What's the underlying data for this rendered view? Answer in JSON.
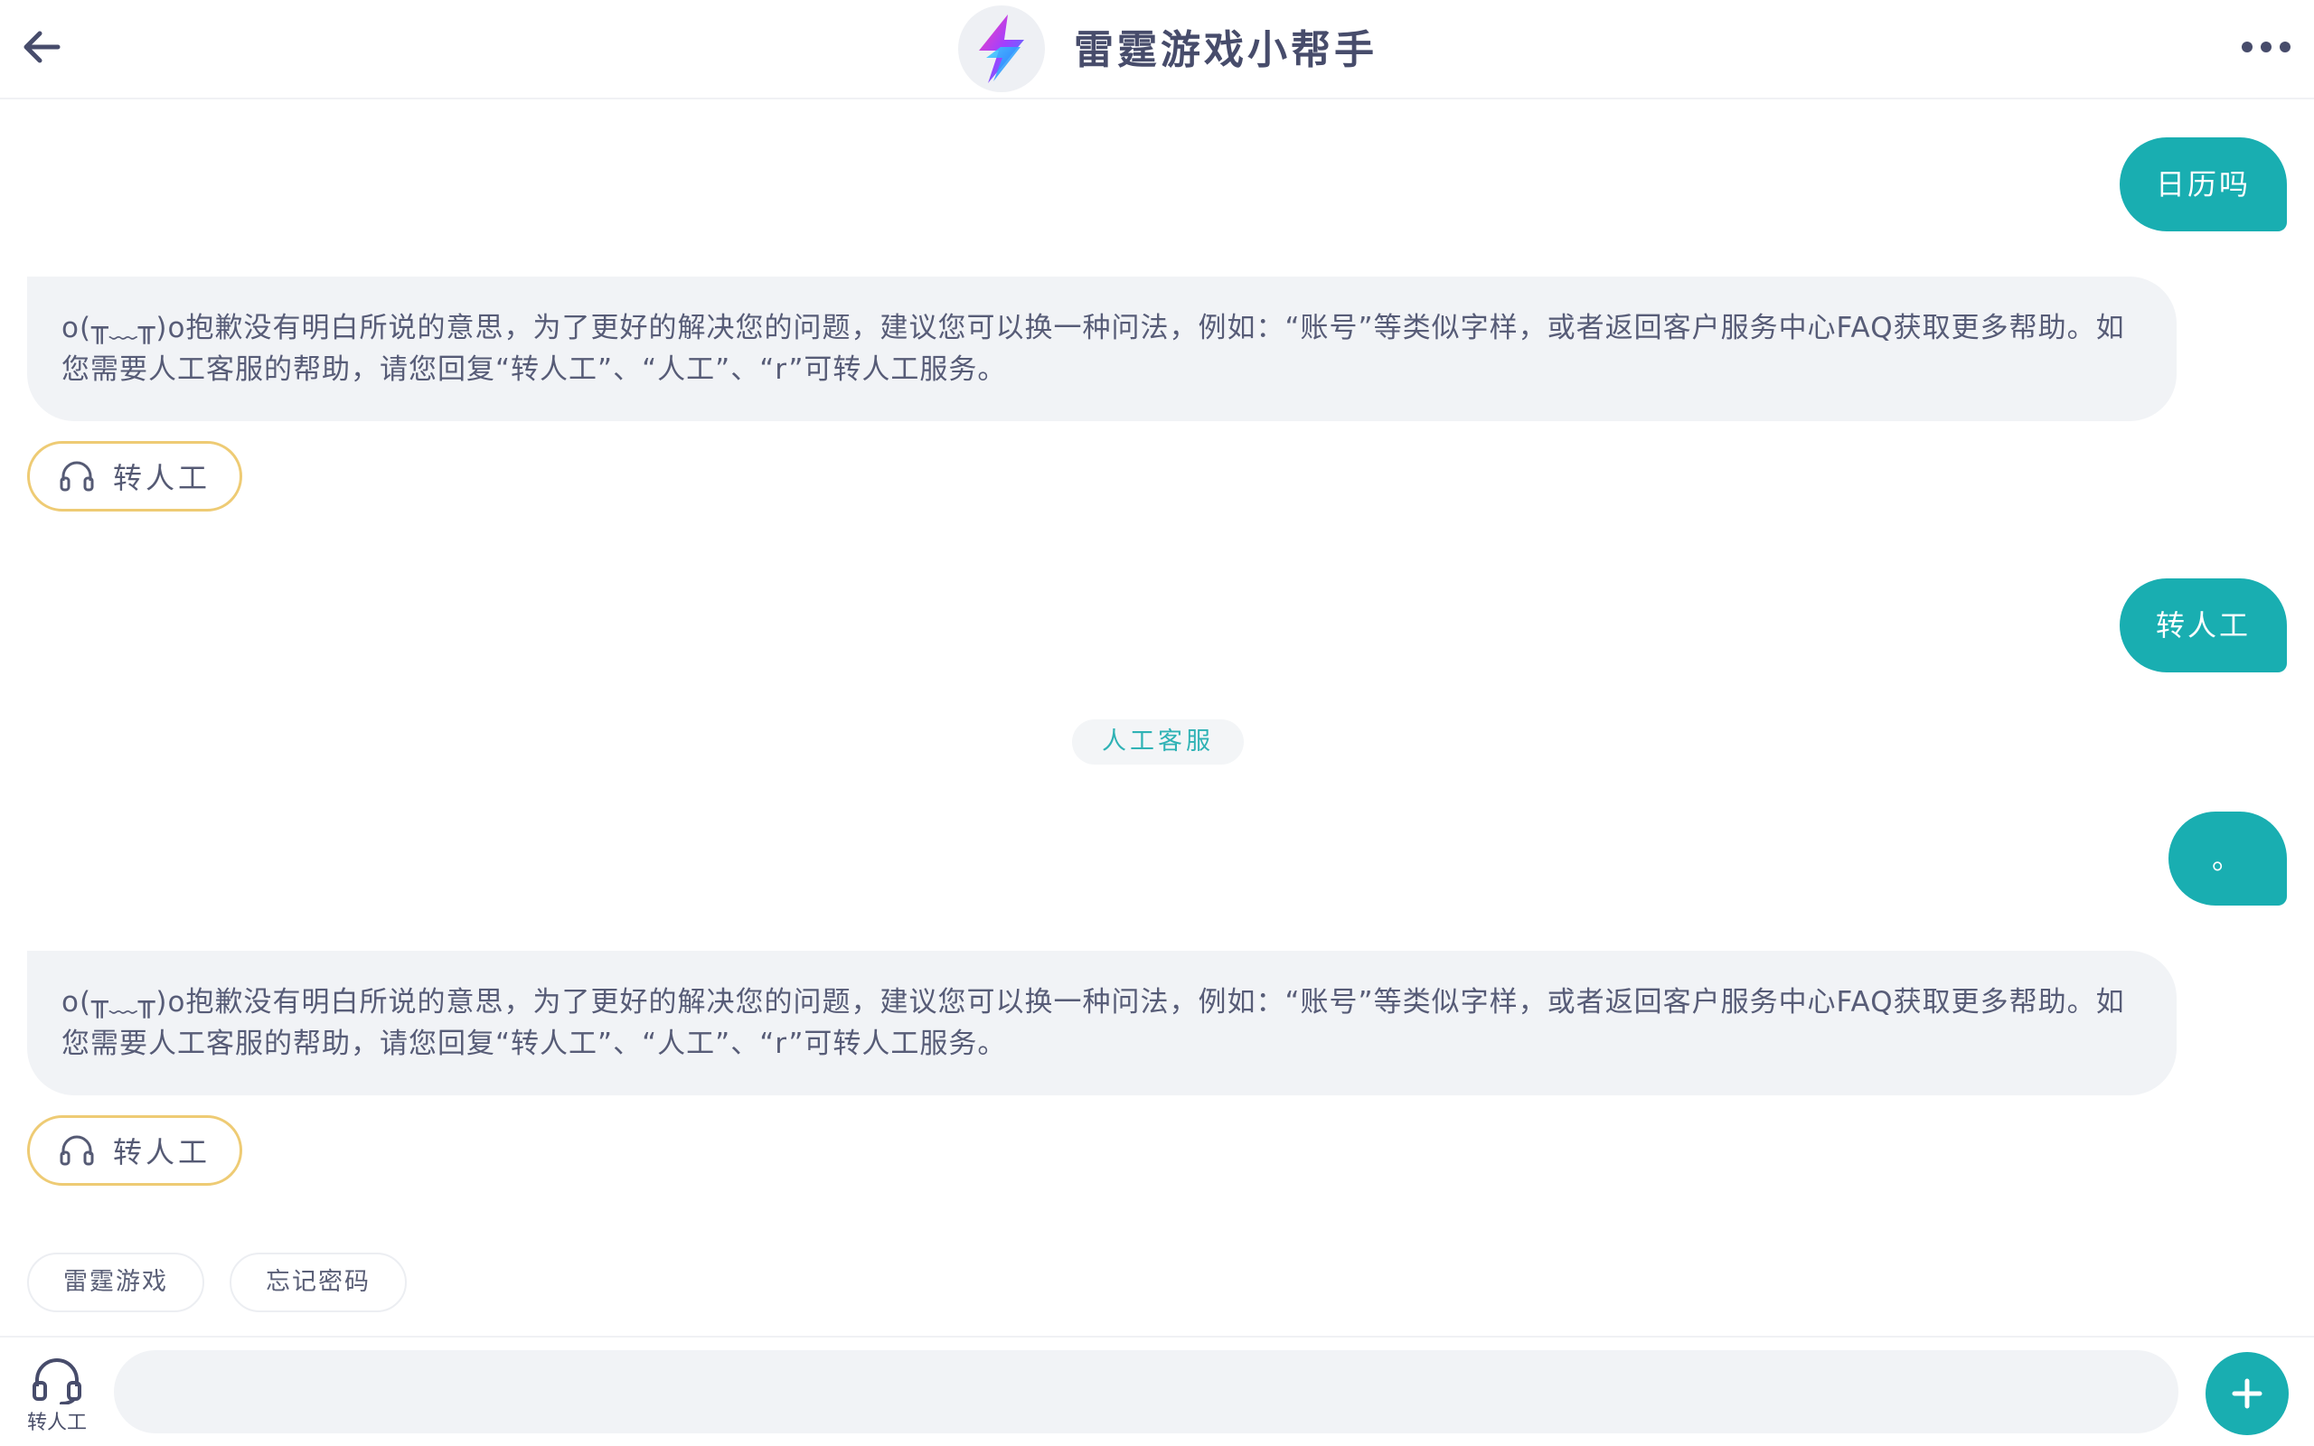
{
  "header": {
    "title": "雷霆游戏小帮手",
    "back_icon": "arrow-left-icon",
    "more_icon": "more-horizontal-icon",
    "logo_icon": "lightning-logo-icon"
  },
  "messages": [
    {
      "role": "user",
      "text": "日历吗"
    },
    {
      "role": "bot",
      "text": "o(╥﹏╥)o抱歉没有明白所说的意思，为了更好的解决您的问题，建议您可以换一种问法，例如：“账号”等类似字样，或者返回客户服务中心FAQ获取更多帮助。如您需要人工客服的帮助，请您回复“转人工”、“人工”、“r”可转人工服务。"
    },
    {
      "role": "chip",
      "text": "转人工",
      "icon": "headset-icon"
    },
    {
      "role": "user",
      "text": "转人工"
    },
    {
      "role": "system",
      "text": "人工客服"
    },
    {
      "role": "user",
      "text": "。"
    },
    {
      "role": "bot",
      "text": "o(╥﹏╥)o抱歉没有明白所说的意思，为了更好的解决您的问题，建议您可以换一种问法，例如：“账号”等类似字样，或者返回客户服务中心FAQ获取更多帮助。如您需要人工客服的帮助，请您回复“转人工”、“人工”、“r”可转人工服务。"
    },
    {
      "role": "chip",
      "text": "转人工",
      "icon": "headset-icon"
    }
  ],
  "quick_replies": [
    "雷霆游戏",
    "忘记密码"
  ],
  "bottom_bar": {
    "agent_label": "转人工",
    "agent_icon": "headset-icon",
    "input_value": "",
    "input_placeholder": "",
    "plus_icon": "plus-icon"
  },
  "colors": {
    "accent": "#19aeb1",
    "bot_bubble": "#f1f3f6",
    "chip_border": "#eecb74",
    "title_text": "#474c6b"
  }
}
